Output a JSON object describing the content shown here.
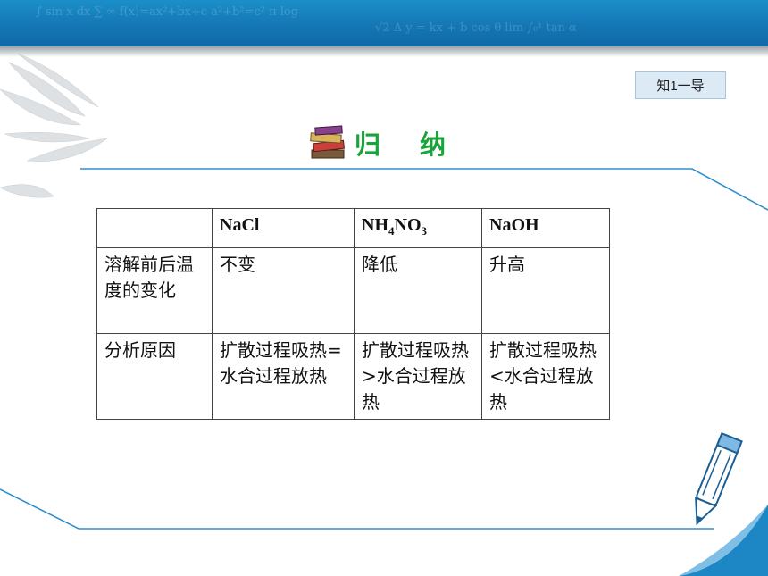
{
  "tag_label": "知1一导",
  "heading": "归纳",
  "table": {
    "header": [
      "",
      "NaCl",
      "NH4NO3",
      "NaOH"
    ],
    "header_nh4no3": {
      "a": "NH",
      "sub1": "4",
      "b": "NO",
      "sub2": "3"
    },
    "rows": [
      {
        "label": "溶解前后温度的变化",
        "cells": [
          "不变",
          "降低",
          "升高"
        ]
      },
      {
        "label": "分析原因",
        "cells": [
          "扩散过程吸热=水合过程放热",
          "扩散过程吸热>水合过程放热",
          "扩散过程吸热<水合过程放热"
        ]
      }
    ]
  },
  "colors": {
    "banner": "#1475b3",
    "heading": "#1aa33a",
    "line": "#2f8fd0"
  },
  "icons": [
    "books-icon",
    "leaves-decoration",
    "pen-icon",
    "page-curl"
  ]
}
